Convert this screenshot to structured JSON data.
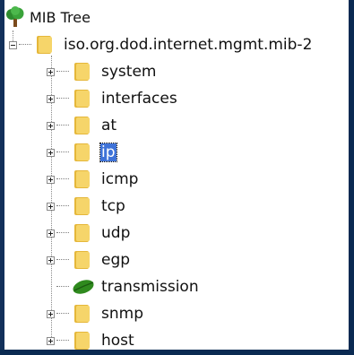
{
  "header": {
    "title": "MIB Tree",
    "icon": "tree-icon"
  },
  "root": {
    "label": "iso.org.dod.internet.mgmt.mib-2",
    "expanded": true,
    "icon": "folder-icon"
  },
  "children": [
    {
      "label": "system",
      "icon": "folder-icon",
      "expandable": true
    },
    {
      "label": "interfaces",
      "icon": "folder-icon",
      "expandable": true
    },
    {
      "label": "at",
      "icon": "folder-icon",
      "expandable": true
    },
    {
      "label": "ip",
      "icon": "folder-icon",
      "expandable": true,
      "selected": true
    },
    {
      "label": "icmp",
      "icon": "folder-icon",
      "expandable": true
    },
    {
      "label": "tcp",
      "icon": "folder-icon",
      "expandable": true
    },
    {
      "label": "udp",
      "icon": "folder-icon",
      "expandable": true
    },
    {
      "label": "egp",
      "icon": "folder-icon",
      "expandable": true
    },
    {
      "label": "transmission",
      "icon": "leaf-icon",
      "expandable": false
    },
    {
      "label": "snmp",
      "icon": "folder-icon",
      "expandable": true
    },
    {
      "label": "host",
      "icon": "folder-icon",
      "expandable": true
    }
  ],
  "colors": {
    "selection": "#3f73d8",
    "folder": "#f2c84b",
    "leaf": "#2f8a1e"
  }
}
